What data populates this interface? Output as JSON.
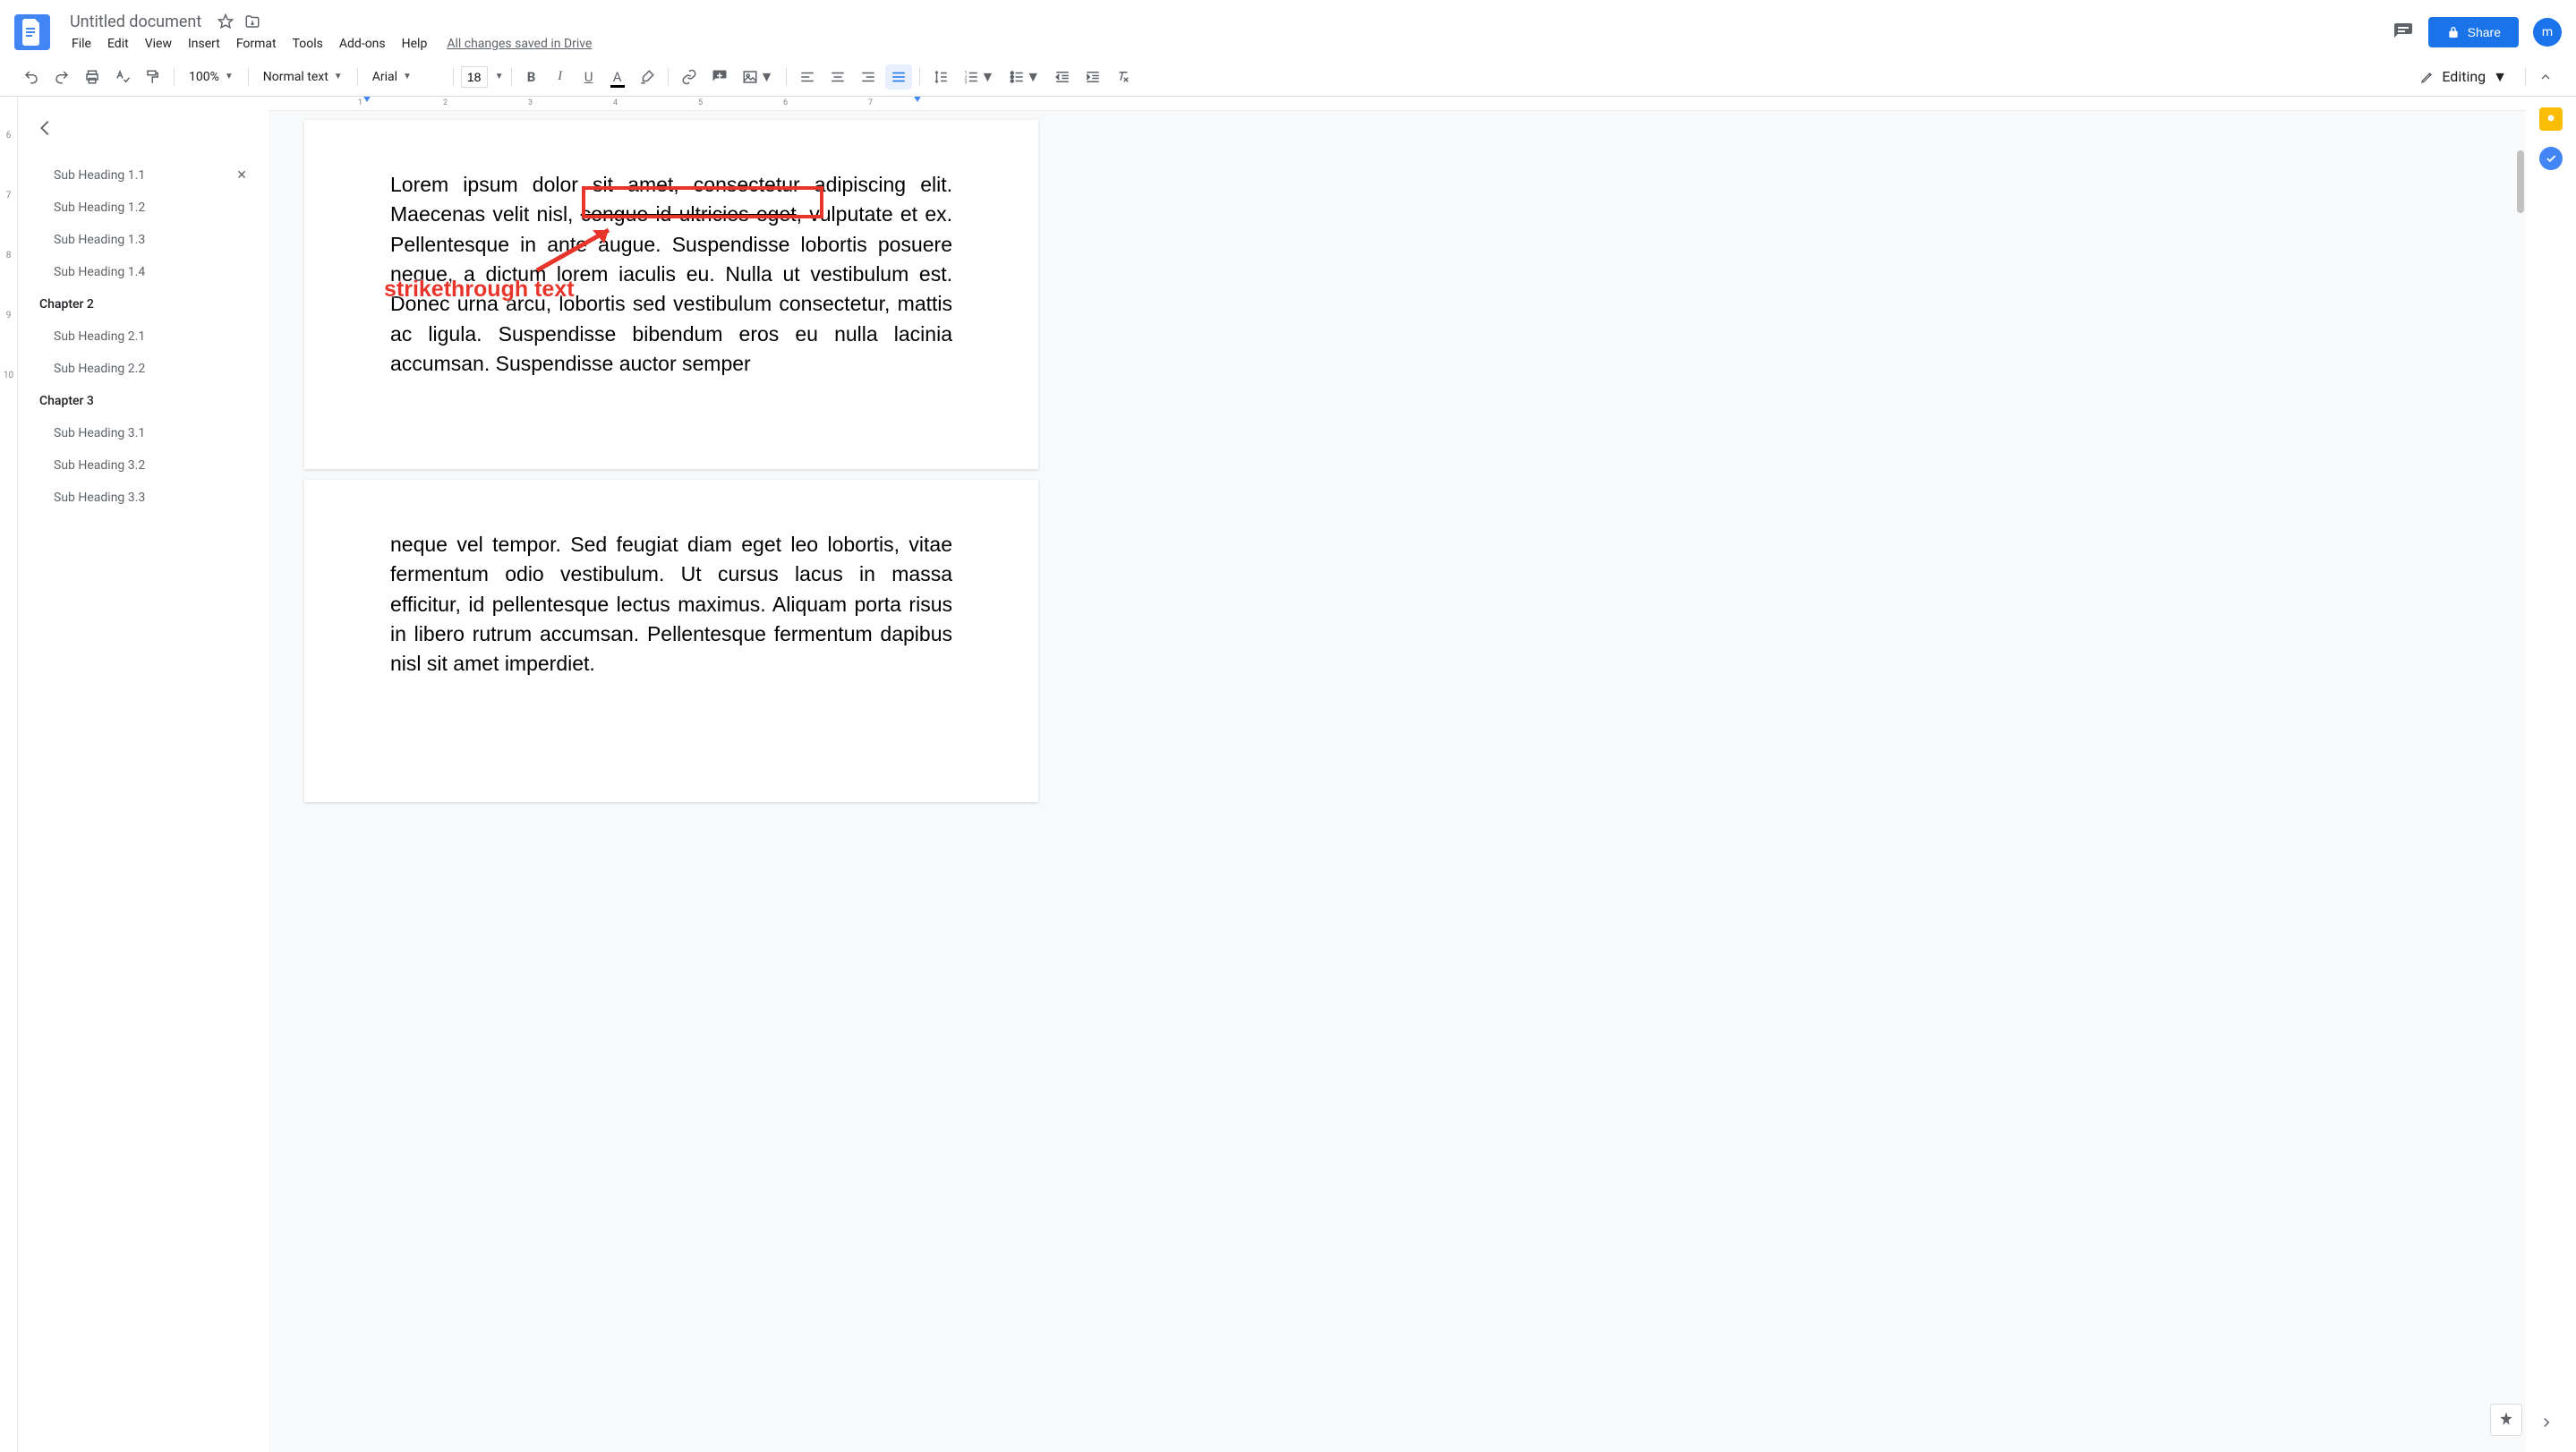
{
  "header": {
    "title": "Untitled document",
    "saved_status": "All changes saved in Drive",
    "share_label": "Share",
    "avatar_letter": "m"
  },
  "menu": {
    "file": "File",
    "edit": "Edit",
    "view": "View",
    "insert": "Insert",
    "format": "Format",
    "tools": "Tools",
    "addons": "Add-ons",
    "help": "Help"
  },
  "toolbar": {
    "zoom": "100%",
    "style": "Normal text",
    "font": "Arial",
    "font_size": "18",
    "mode": "Editing"
  },
  "ruler_h": {
    "ticks": [
      "1",
      "2",
      "3",
      "4",
      "5",
      "6",
      "7"
    ]
  },
  "ruler_v": [
    "6",
    "7",
    "8",
    "9",
    "10"
  ],
  "outline": {
    "items": [
      {
        "label": "Sub Heading 1.1",
        "level": "sub",
        "sel": true
      },
      {
        "label": "Sub Heading 1.2",
        "level": "sub"
      },
      {
        "label": "Sub Heading 1.3",
        "level": "sub"
      },
      {
        "label": "Sub Heading 1.4",
        "level": "sub"
      },
      {
        "label": "Chapter 2",
        "level": "chapter"
      },
      {
        "label": "Sub Heading 2.1",
        "level": "sub"
      },
      {
        "label": "Sub Heading 2.2",
        "level": "sub"
      },
      {
        "label": "Chapter 3",
        "level": "chapter"
      },
      {
        "label": "Sub Heading 3.1",
        "level": "sub"
      },
      {
        "label": "Sub Heading 3.2",
        "level": "sub"
      },
      {
        "label": "Sub Heading 3.3",
        "level": "sub"
      }
    ]
  },
  "document": {
    "page1": {
      "pre": "Lorem ipsum dolor sit amet, consectetur adipiscing elit. Maecenas velit nisl, ",
      "struck": "congue id ultricies eget",
      "post": ", vulputate et ex. Pellentesque in ante augue. Suspendisse lobortis posuere neque, a dictum lorem iaculis eu. Nulla ut vestibulum est. Donec urna arcu, lobortis sed vestibulum consectetur, mattis ac ligula. Suspendisse bibendum eros eu nulla lacinia accumsan. Suspendisse auctor semper"
    },
    "page2": "neque vel tempor. Sed feugiat diam eget leo lobortis, vitae fermentum odio vestibulum. Ut cursus lacus in massa efficitur, id pellentesque lectus maximus. Aliquam porta risus in libero rutrum accumsan. Pellentesque fermentum dapibus nisl sit amet imperdiet."
  },
  "annotation": {
    "label": "strikethrough text"
  }
}
